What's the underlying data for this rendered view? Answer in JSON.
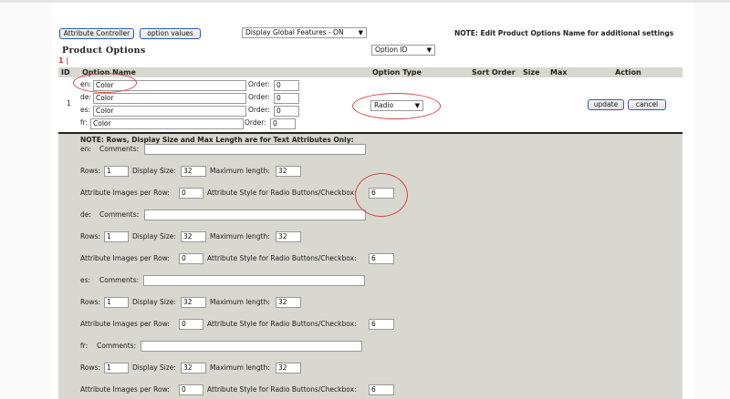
{
  "toolbar": {
    "attr_controller_label": "Attribute Controller",
    "option_values_label": "option values",
    "global_features_value": "Display Global Features - ON",
    "note": "NOTE: Edit Product Options Name for additional settings"
  },
  "section": {
    "title": "Product Options",
    "sort_select_value": "Option ID",
    "paging": "1 |"
  },
  "columns": {
    "id": "ID",
    "name": "Option Name",
    "type": "Option Type",
    "sort": "Sort Order",
    "size": "Size",
    "max": "Max",
    "action": "Action"
  },
  "option": {
    "id": "1",
    "type_value": "Radio",
    "update_label": "update",
    "cancel_label": "cancel",
    "order_label": "Order:",
    "names": [
      {
        "lang": "en:",
        "value": "Color",
        "order": "0"
      },
      {
        "lang": "de:",
        "value": "Color",
        "order": "0"
      },
      {
        "lang": "es:",
        "value": "Color",
        "order": "0"
      },
      {
        "lang": "fr:",
        "value": "Color",
        "order": "0"
      }
    ]
  },
  "text_attr": {
    "note": "NOTE: Rows, Display Size and Max Length are for Text Attributes Only:",
    "comments_label": "Comments:",
    "rows_label": "Rows:",
    "display_size_label": "Display Size:",
    "max_length_label": "Maximum length:",
    "images_per_row_label": "Attribute Images per Row:",
    "style_label": "Attribute Style for Radio Buttons/Checkbox:",
    "langs": [
      {
        "lang": "en:",
        "rows": "1",
        "display_size": "32",
        "max_length": "32",
        "images_per_row": "0",
        "style": "6"
      },
      {
        "lang": "de:",
        "rows": "1",
        "display_size": "32",
        "max_length": "32",
        "images_per_row": "0",
        "style": "6"
      },
      {
        "lang": "es:",
        "rows": "1",
        "display_size": "32",
        "max_length": "32",
        "images_per_row": "0",
        "style": "6"
      },
      {
        "lang": "fr:",
        "rows": "1",
        "display_size": "32",
        "max_length": "32",
        "images_per_row": "0",
        "style": "6"
      }
    ]
  },
  "colors": {
    "annotation": "#d94545",
    "panel": "#d8d8d0"
  }
}
